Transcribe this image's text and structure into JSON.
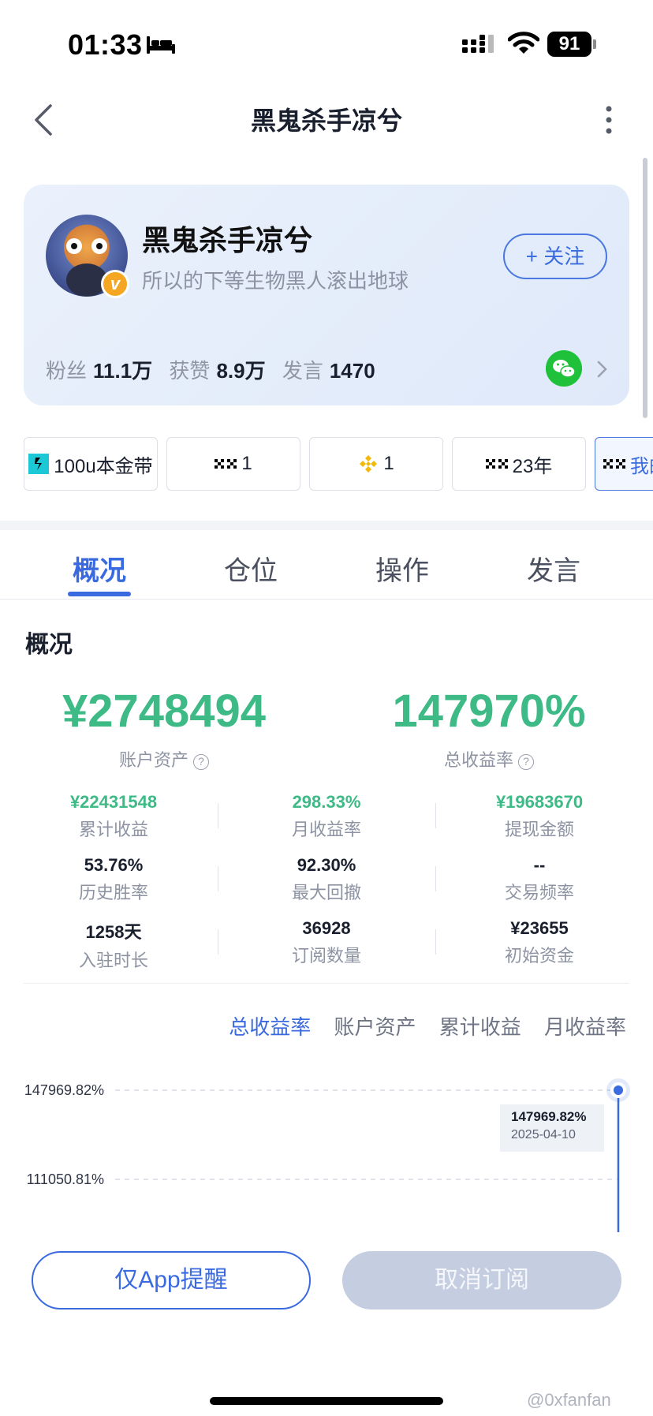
{
  "status_bar": {
    "time": "01:33",
    "battery": "91"
  },
  "nav": {
    "title": "黑鬼杀手凉兮"
  },
  "profile": {
    "name": "黑鬼杀手凉兮",
    "bio": "所以的下等生物黑人滚出地球",
    "badge": "v",
    "follow_label": "+ 关注",
    "stats": {
      "fans_label": "粉丝",
      "fans_value": "11.1万",
      "likes_label": "获赞",
      "likes_value": "8.9万",
      "posts_label": "发言",
      "posts_value": "1470"
    }
  },
  "tags": [
    {
      "label": "100u本金带",
      "icon": "bitget-icon"
    },
    {
      "label": "1",
      "icon": "okx-icon"
    },
    {
      "label": "1",
      "icon": "binance-icon"
    },
    {
      "label": "23年",
      "icon": "okx-icon"
    },
    {
      "label": "我的",
      "icon": "okx-icon"
    }
  ],
  "tabs": [
    "概况",
    "仓位",
    "操作",
    "发言"
  ],
  "overview": {
    "title": "概况",
    "assets_value": "¥2748494",
    "assets_label": "账户资产",
    "return_value": "147970%",
    "return_label": "总收益率",
    "metrics": [
      {
        "value": "¥22431548",
        "label": "累计收益",
        "green": true
      },
      {
        "value": "298.33%",
        "label": "月收益率",
        "green": true
      },
      {
        "value": "¥19683670",
        "label": "提现金额",
        "green": true
      },
      {
        "value": "53.76%",
        "label": "历史胜率",
        "green": false
      },
      {
        "value": "92.30%",
        "label": "最大回撤",
        "green": false
      },
      {
        "value": "--",
        "label": "交易频率",
        "green": false
      },
      {
        "value": "1258天",
        "label": "入驻时长",
        "green": false
      },
      {
        "value": "36928",
        "label": "订阅数量",
        "green": false
      },
      {
        "value": "¥23655",
        "label": "初始资金",
        "green": false
      }
    ]
  },
  "chart_tabs": [
    "总收益率",
    "账户资产",
    "累计收益",
    "月收益率"
  ],
  "chart_data": {
    "type": "line",
    "y_ticks": [
      "147969.82%",
      "111050.81%"
    ],
    "points": [
      {
        "x": "2025-04-10",
        "y": 147969.82
      }
    ],
    "tooltip": {
      "value": "147969.82%",
      "date": "2025-04-10"
    },
    "accent": "#3a6ae0"
  },
  "actions": {
    "remind_label": "仅App提醒",
    "unsubscribe_label": "取消订阅"
  },
  "watermark": "@0xfanfan",
  "colors": {
    "accent": "#3a6ae0",
    "profit": "#3dba85"
  }
}
